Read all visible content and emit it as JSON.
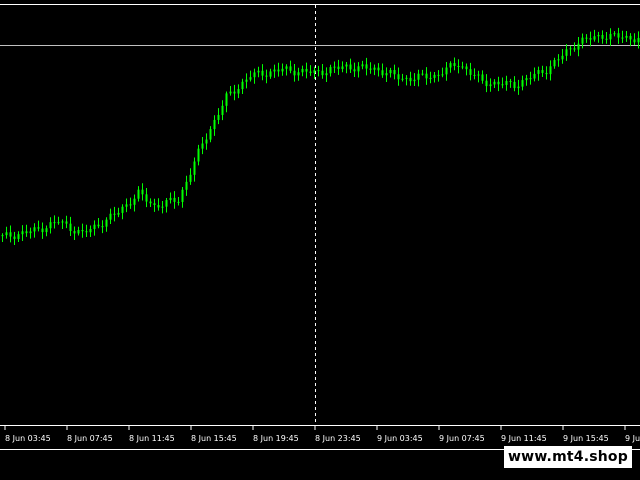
{
  "colors": {
    "background": "#000000",
    "candle_up": "#00ff00",
    "candle_down": "#00ff00",
    "axis": "#ffffff",
    "horizontal_line": "#c0c0c0",
    "vertical_line": "#ffffff",
    "watermark_bg": "#ffffff",
    "watermark_text": "#000000"
  },
  "watermark": {
    "text": "www.mt4.shop"
  },
  "chart_data": {
    "type": "candlestick",
    "x_axis_labels": [
      "8 Jun 03:45",
      "8 Jun 07:45",
      "8 Jun 11:45",
      "8 Jun 15:45",
      "8 Jun 19:45",
      "8 Jun 23:45",
      "9 Jun 03:45",
      "9 Jun 07:45",
      "9 Jun 11:45",
      "9 Jun 15:45",
      "9 Ju"
    ],
    "title": "",
    "xlabel": "",
    "ylabel": "",
    "y_scale": "price (unlabeled)",
    "ylim": [
      0,
      100
    ],
    "series_close_trace": [
      {
        "x_index": 0,
        "close": 30
      },
      {
        "x_index": 8,
        "close": 32
      },
      {
        "x_index": 14,
        "close": 35
      },
      {
        "x_index": 20,
        "close": 31
      },
      {
        "x_index": 28,
        "close": 37
      },
      {
        "x_index": 34,
        "close": 44
      },
      {
        "x_index": 38,
        "close": 40
      },
      {
        "x_index": 44,
        "close": 42
      },
      {
        "x_index": 50,
        "close": 60
      },
      {
        "x_index": 56,
        "close": 75
      },
      {
        "x_index": 62,
        "close": 82
      },
      {
        "x_index": 70,
        "close": 84
      },
      {
        "x_index": 78,
        "close": 83
      },
      {
        "x_index": 86,
        "close": 85
      },
      {
        "x_index": 94,
        "close": 84
      },
      {
        "x_index": 100,
        "close": 81
      },
      {
        "x_index": 108,
        "close": 82
      },
      {
        "x_index": 114,
        "close": 86
      },
      {
        "x_index": 120,
        "close": 80
      },
      {
        "x_index": 128,
        "close": 79
      },
      {
        "x_index": 136,
        "close": 84
      },
      {
        "x_index": 144,
        "close": 93
      },
      {
        "x_index": 150,
        "close": 95
      },
      {
        "x_index": 159,
        "close": 94
      }
    ],
    "horizontal_line": {
      "level": 92
    },
    "vertical_line": {
      "at_label": "8 Jun 23:45"
    }
  }
}
